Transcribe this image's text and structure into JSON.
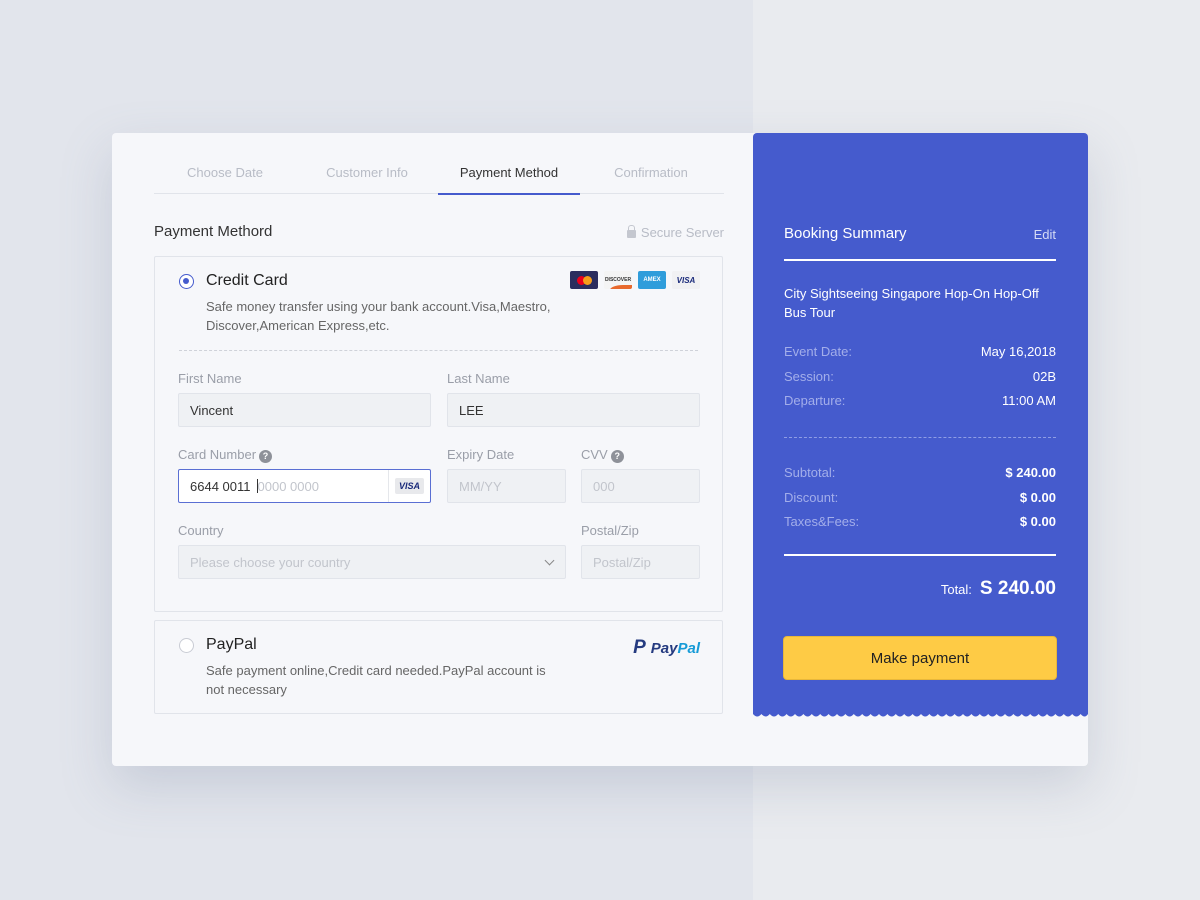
{
  "steps": [
    "Choose Date",
    "Customer Info",
    "Payment Method",
    "Confirmation"
  ],
  "active_step": 2,
  "section_title": "Payment Methord",
  "secure_label": "Secure Server",
  "credit_card": {
    "title": "Credit Card",
    "description": "Safe money transfer using your bank account.Visa,Maestro, Discover,American Express,etc.",
    "selected": true,
    "brands": [
      "mastercard",
      "DISCOVER",
      "AMEX",
      "VISA"
    ],
    "first_name": {
      "label": "First Name",
      "value": "Vincent"
    },
    "last_name": {
      "label": "Last Name",
      "value": "LEE"
    },
    "card_number": {
      "label": "Card Number",
      "value": "6644  0011",
      "placeholder_rest": "0000  0000",
      "brand": "VISA"
    },
    "expiry": {
      "label": "Expiry Date",
      "placeholder": "MM/YY"
    },
    "cvv": {
      "label": "CVV",
      "placeholder": "000"
    },
    "country": {
      "label": "Country",
      "placeholder": "Please choose your country"
    },
    "postal": {
      "label": "Postal/Zip",
      "placeholder": "Postal/Zip"
    },
    "help_glyph": "?"
  },
  "paypal": {
    "title": "PayPal",
    "description": "Safe payment online,Credit card needed.PayPal account is not necessary",
    "selected": false,
    "logo_pay": "Pay",
    "logo_pal": "Pal",
    "logo_icon": "P"
  },
  "summary": {
    "title": "Booking Summary",
    "edit": "Edit",
    "tour": "City Sightseeing Singapore Hop-On Hop-Off Bus Tour",
    "details": [
      {
        "k": "Event Date:",
        "v": "May 16,2018"
      },
      {
        "k": "Session:",
        "v": "02B"
      },
      {
        "k": "Departure:",
        "v": "11:00 AM"
      }
    ],
    "costs": [
      {
        "k": "Subtotal:",
        "v": "$ 240.00"
      },
      {
        "k": "Discount:",
        "v": "$ 0.00"
      },
      {
        "k": "Taxes&Fees:",
        "v": "$ 0.00"
      }
    ],
    "total_label": "Total:",
    "total_value": "S 240.00",
    "pay_button": "Make payment"
  },
  "colors": {
    "accent": "#455bcd",
    "button": "#fecb45"
  }
}
